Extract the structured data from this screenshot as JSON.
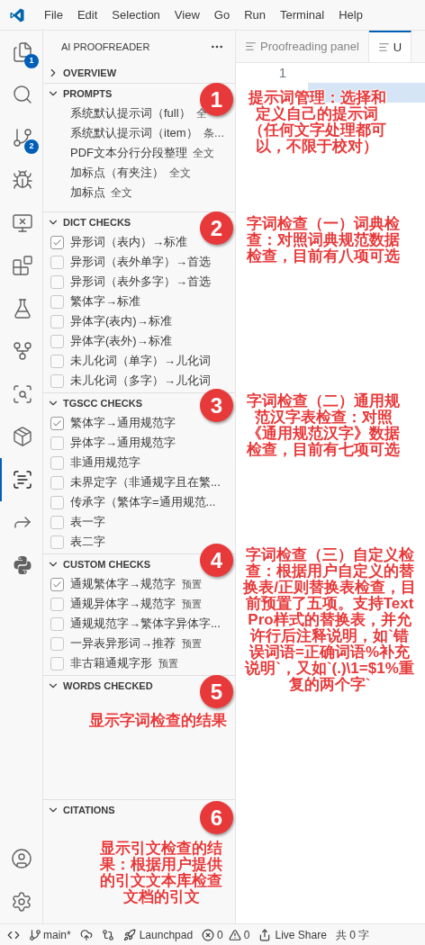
{
  "menu_bar": {
    "items": [
      "File",
      "Edit",
      "Selection",
      "View",
      "Go",
      "Run",
      "Terminal",
      "Help"
    ]
  },
  "activity_bar": {
    "items": [
      {
        "badge": "1",
        "selected": false
      },
      {
        "selected": false
      },
      {
        "badge": "2",
        "selected": false
      },
      {
        "selected": false
      },
      {
        "selected": false
      },
      {
        "selected": false
      },
      {
        "selected": false
      },
      {
        "selected": false
      },
      {
        "selected": false
      },
      {
        "selected": false
      },
      {
        "selected": true
      },
      {
        "selected": false
      },
      {
        "selected": false
      }
    ]
  },
  "sidebar": {
    "title": "AI PROOFREADER",
    "sections": [
      {
        "title": "OVERVIEW",
        "expanded": false
      },
      {
        "title": "PROMPTS",
        "expanded": true,
        "kind": "prompts",
        "items": [
          {
            "name": "系统默认提示词（full）",
            "tag": "全"
          },
          {
            "name": "系统默认提示词（item）",
            "tag": "条…"
          },
          {
            "name": "PDF文本分行分段整理",
            "tag": "全文"
          },
          {
            "name": "加标点（有夹注）",
            "tag": "全文"
          },
          {
            "name": "加标点",
            "tag": "全文"
          }
        ]
      },
      {
        "title": "DICT CHECKS",
        "expanded": true,
        "kind": "checks",
        "items": [
          {
            "label": "异形词（表内）→标准",
            "checked": true
          },
          {
            "label": "异形词（表外单字）→首选",
            "checked": false
          },
          {
            "label": "异形词（表外多字）→首选",
            "checked": false
          },
          {
            "label": "繁体字→标准",
            "checked": false
          },
          {
            "label": "异体字(表内)→标准",
            "checked": false
          },
          {
            "label": "异体字(表外)→标准",
            "checked": false
          },
          {
            "label": "未儿化词（单字）→儿化词",
            "checked": false
          },
          {
            "label": "未儿化词（多字）→儿化词",
            "checked": false
          }
        ]
      },
      {
        "title": "TGSCC CHECKS",
        "expanded": true,
        "kind": "checks",
        "items": [
          {
            "label": "繁体字→通用规范字",
            "checked": true
          },
          {
            "label": "异体字→通用规范字",
            "checked": false
          },
          {
            "label": "非通用规范字",
            "checked": false
          },
          {
            "label": "未界定字（非通规字且在繁...",
            "checked": false
          },
          {
            "label": "传承字（繁体字=通用规范...",
            "checked": false
          },
          {
            "label": "表一字",
            "checked": false
          },
          {
            "label": "表二字",
            "checked": false
          }
        ]
      },
      {
        "title": "CUSTOM CHECKS",
        "expanded": true,
        "kind": "checks",
        "items": [
          {
            "label": "通规繁体字→规范字",
            "tag": "预置",
            "checked": true
          },
          {
            "label": "通规异体字→规范字",
            "tag": "预置",
            "checked": false
          },
          {
            "label": "通规规范字→繁体字异体字...",
            "checked": false
          },
          {
            "label": "一异表异形词→推荐",
            "tag": "预置",
            "checked": false
          },
          {
            "label": "非古籍通规字形",
            "tag": "预置",
            "checked": false
          }
        ]
      },
      {
        "title": "WORDS CHECKED",
        "expanded": true,
        "kind": "empty"
      },
      {
        "title": "CITATIONS",
        "expanded": true,
        "kind": "empty"
      }
    ]
  },
  "editor": {
    "tabs": [
      {
        "label": "Proofreading panel",
        "selected": false
      },
      {
        "label": "U",
        "selected": true
      }
    ],
    "line_numbers": [
      "1"
    ]
  },
  "annotations": [
    {
      "number": "1",
      "text": "提示词管理：选择和定义自己的提示词（任何文字处理都可以，不限于校对）"
    },
    {
      "number": "2",
      "text": "字词检查（一）词典检查：对照词典规范数据检查，目前有八项可选"
    },
    {
      "number": "3",
      "text": "字词检查（二）通用规范汉字表检查：对照《通用规范汉字》数据检查，目前有七项可选"
    },
    {
      "number": "4",
      "text": "字词检查（三）自定义检查：根据用户自定义的替换表/正则替换表检查，目前预置了五项。支持TextPro样式的替换表，并允许行后注释说明，如`错误词语=正确词语%补充说明`，又如`(.)\\1=$1%重复的两个字`"
    },
    {
      "number": "5",
      "text": "显示字词检查的结果"
    },
    {
      "number": "6",
      "text": "显示引文检查的结果：根据用户提供的引文文本库检查文档的引文"
    }
  ],
  "status_bar": {
    "branch": "main*",
    "launchpad": "Launchpad",
    "errors": "0",
    "warnings": "0",
    "live_share": "Live Share",
    "word_count": "共 0 字"
  }
}
